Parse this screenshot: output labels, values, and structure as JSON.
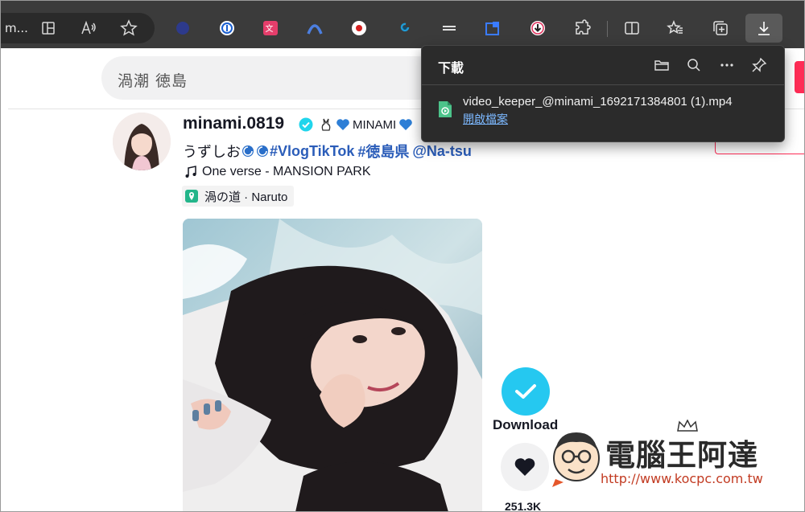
{
  "browser": {
    "address_text": "m...",
    "extension_icons": [
      "firefox-like-icon",
      "1password-icon",
      "translate-icon",
      "arc-icon",
      "record-icon",
      "tiktok-icon",
      "scroll-icon",
      "picture-in-picture-icon",
      "download-helper-icon"
    ],
    "toolbar_icons": [
      "extensions-icon",
      "split-screen-icon",
      "favorites-icon",
      "collections-icon",
      "downloads-icon"
    ]
  },
  "downloads": {
    "title": "下載",
    "file_name": "video_keeper_@minami_1692171384801 (1).mp4",
    "open_label": "開啟檔案"
  },
  "search": {
    "query": "渦潮 徳島"
  },
  "post": {
    "username": "minami.0819",
    "nickname": "MINAMI",
    "desc_text": "うずしお",
    "tag1": "#VlogTikTok",
    "tag2": "#徳島県",
    "mention": "@Na-tsu",
    "music": "One verse - MANSION PARK",
    "location": "渦の道 · Naruto"
  },
  "actions": {
    "download_label": "Download",
    "likes": "251.3K"
  },
  "watermark": {
    "title": "電腦王阿達",
    "url": "http://www.kocpc.com.tw"
  },
  "colors": {
    "chrome_bg": "#3b3b3b",
    "flyout_bg": "#2b2b2b",
    "link": "#7cb8ff",
    "hashtag": "#2b5db9",
    "download_button": "#25c8f0",
    "tiktok_red": "#fe2c55"
  }
}
